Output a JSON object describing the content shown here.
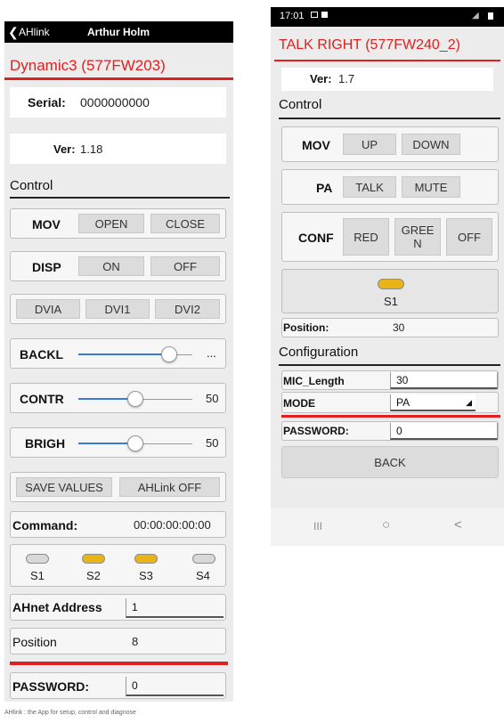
{
  "colors": {
    "accent_red": "#e02020",
    "slider_blue": "#3a7bd5",
    "led_on": "#e8b418",
    "led_off": "#d8d8d8"
  },
  "left": {
    "status": {
      "back_label": "AHlink",
      "user": "Arthur Holm"
    },
    "title": "Dynamic3 (577FW203)",
    "serial": {
      "label": "Serial:",
      "value": "0000000000"
    },
    "ver": {
      "label": "Ver:",
      "value": "1.18"
    },
    "control_heading": "Control",
    "mov": {
      "label": "MOV",
      "open": "OPEN",
      "close": "CLOSE"
    },
    "disp": {
      "label": "DISP",
      "on": "ON",
      "off": "OFF"
    },
    "dvi": {
      "dvia": "DVIA",
      "dvi1": "DVI1",
      "dvi2": "DVI2"
    },
    "backl": {
      "label": "BACKL",
      "value": "...",
      "level": 0.8
    },
    "contr": {
      "label": "CONTR",
      "value": "50",
      "level": 0.5
    },
    "brigh": {
      "label": "BRIGH",
      "value": "50",
      "level": 0.5
    },
    "save_values": "SAVE VALUES",
    "ahlink_off": "AHLink OFF",
    "command": {
      "label": "Command:",
      "value": "00:00:00:00:00"
    },
    "leds": [
      {
        "label": "S1",
        "state": "off"
      },
      {
        "label": "S2",
        "state": "on"
      },
      {
        "label": "S3",
        "state": "on"
      },
      {
        "label": "S4",
        "state": "off"
      }
    ],
    "ahnet": {
      "label": "AHnet Address",
      "value": "1"
    },
    "position": {
      "label": "Position",
      "value": "8"
    },
    "password": {
      "label": "PASSWORD:",
      "value": "0"
    }
  },
  "right": {
    "status": {
      "time": "17:01"
    },
    "title": "TALK RIGHT (577FW240_2)",
    "ver": {
      "label": "Ver:",
      "value": "1.7"
    },
    "control_heading": "Control",
    "mov": {
      "label": "MOV",
      "up": "UP",
      "down": "DOWN"
    },
    "pa": {
      "label": "PA",
      "talk": "TALK",
      "mute": "MUTE"
    },
    "conf": {
      "label": "CONF",
      "red": "RED",
      "green_line1": "GREE",
      "green_line2": "N",
      "off": "OFF"
    },
    "s1": {
      "label": "S1",
      "state": "on"
    },
    "position": {
      "label": "Position:",
      "value": "30"
    },
    "config_heading": "Configuration",
    "mic_length": {
      "label": "MIC_Length",
      "value": "30"
    },
    "mode": {
      "label": "MODE",
      "value": "PA"
    },
    "password": {
      "label": "PASSWORD:",
      "value": "0"
    },
    "back": "BACK",
    "nav": {
      "recents": "III",
      "home": "○",
      "back": "<"
    }
  },
  "caption": "AHlink : the App for setup, control and diagnose"
}
